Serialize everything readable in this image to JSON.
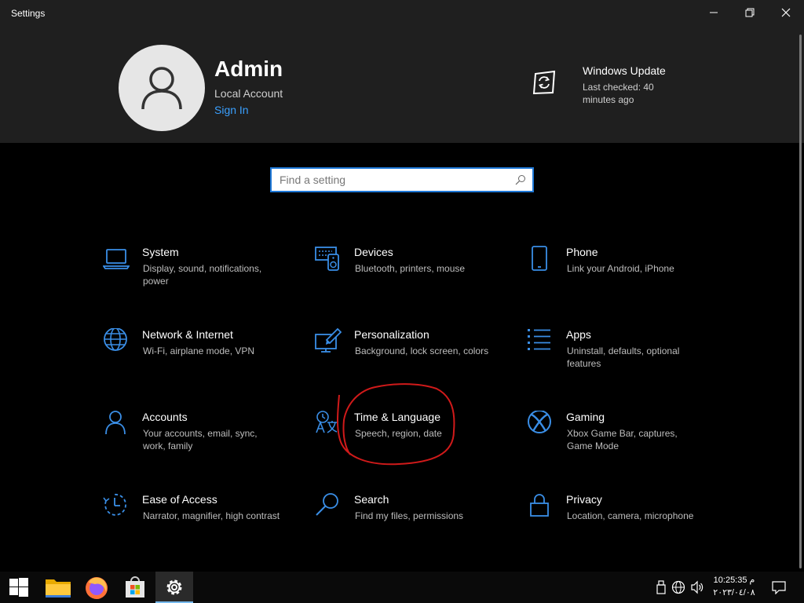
{
  "window": {
    "title": "Settings",
    "minimize_icon": "minimize-icon",
    "restore_icon": "restore-icon",
    "close_icon": "close-icon"
  },
  "header": {
    "user_name": "Admin",
    "account_type": "Local Account",
    "sign_in_label": "Sign In",
    "update_title": "Windows Update",
    "update_status": "Last checked: 40 minutes ago"
  },
  "search": {
    "placeholder": "Find a setting",
    "value": ""
  },
  "tiles": [
    {
      "title": "System",
      "description": "Display, sound, notifications, power",
      "icon": "laptop-icon"
    },
    {
      "title": "Devices",
      "description": "Bluetooth, printers, mouse",
      "icon": "devices-icon"
    },
    {
      "title": "Phone",
      "description": "Link your Android, iPhone",
      "icon": "phone-icon"
    },
    {
      "title": "Network & Internet",
      "description": "Wi-Fi, airplane mode, VPN",
      "icon": "globe-icon"
    },
    {
      "title": "Personalization",
      "description": "Background, lock screen, colors",
      "icon": "paintbrush-icon"
    },
    {
      "title": "Apps",
      "description": "Uninstall, defaults, optional features",
      "icon": "apps-list-icon"
    },
    {
      "title": "Accounts",
      "description": "Your accounts, email, sync, work, family",
      "icon": "person-icon"
    },
    {
      "title": "Time & Language",
      "description": "Speech, region, date",
      "icon": "time-language-icon"
    },
    {
      "title": "Gaming",
      "description": "Xbox Game Bar, captures, Game Mode",
      "icon": "xbox-icon"
    },
    {
      "title": "Ease of Access",
      "description": "Narrator, magnifier, high contrast",
      "icon": "ease-of-access-icon"
    },
    {
      "title": "Search",
      "description": "Find my files, permissions",
      "icon": "search-icon"
    },
    {
      "title": "Privacy",
      "description": "Location, camera, microphone",
      "icon": "lock-icon"
    }
  ],
  "taskbar": {
    "items": [
      "start-icon",
      "file-explorer-icon",
      "firefox-icon",
      "store-icon",
      "settings-icon"
    ],
    "tray": [
      "usb-icon",
      "network-globe-icon",
      "volume-icon"
    ],
    "clock_time": "10:25:35 م",
    "clock_date": "٢٠٢٣/٠٤/٠٨",
    "notifications_icon": "notification-icon"
  },
  "colors": {
    "accent": "#1e78d7",
    "link": "#3aa0ff",
    "annotation": "#d01a1a",
    "header_bg": "#1f1f1f",
    "background": "#000000"
  }
}
